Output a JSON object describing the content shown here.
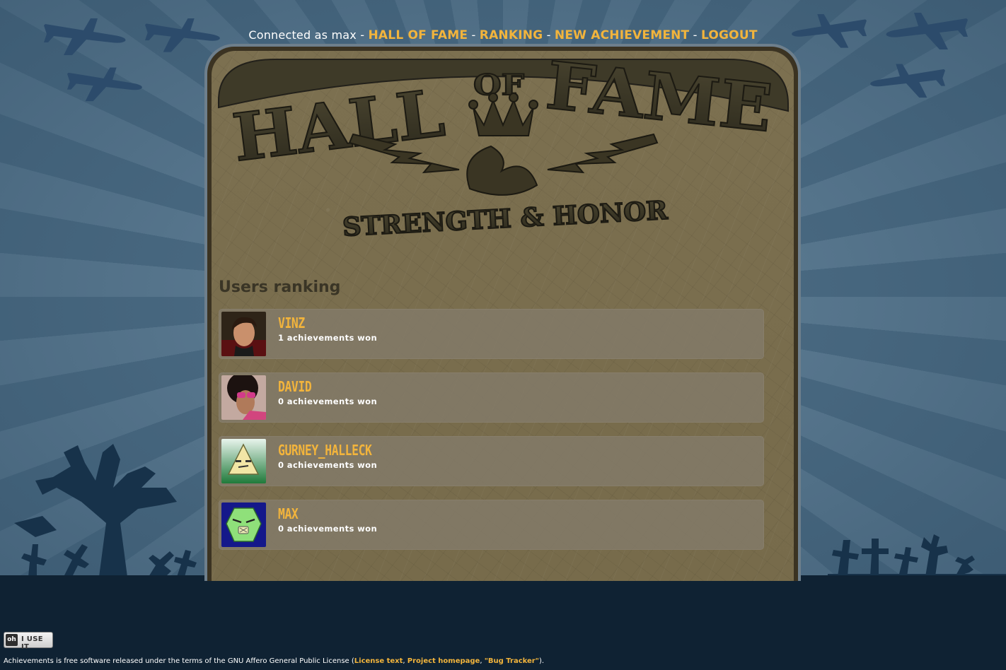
{
  "nav": {
    "connected_prefix": "Connected as",
    "username": "max",
    "sep": "-",
    "links": [
      "HALL OF FAME",
      "RANKING",
      "NEW ACHIEVEMENT",
      "LOGOUT"
    ]
  },
  "logo": {
    "line1a": "HALL",
    "line1b": "OF",
    "line1c": "FAME",
    "line2": "STRENGTH & HONOR"
  },
  "main": {
    "section_title": "Users ranking",
    "users": [
      {
        "name": "VINZ",
        "achievements": "1 achievements won"
      },
      {
        "name": "DAVID",
        "achievements": "0 achievements won"
      },
      {
        "name": "GURNEY_HALLECK",
        "achievements": "0 achievements won"
      },
      {
        "name": "MAX",
        "achievements": "0 achievements won"
      }
    ]
  },
  "badge": {
    "oh": "oh",
    "label": "I USE IT"
  },
  "footer": {
    "text_before": "Achievements is free software released under the terms of the GNU Affero General Public License (",
    "link_license": "License text",
    "comma1": ", ",
    "link_project": "Project homepage",
    "comma2": ", ",
    "link_bugs": "\"Bug Tracker\"",
    "text_after": ")."
  },
  "colors": {
    "accent": "#f2b43c",
    "ground": "#0f2233",
    "panel": "#7a6e4e"
  }
}
